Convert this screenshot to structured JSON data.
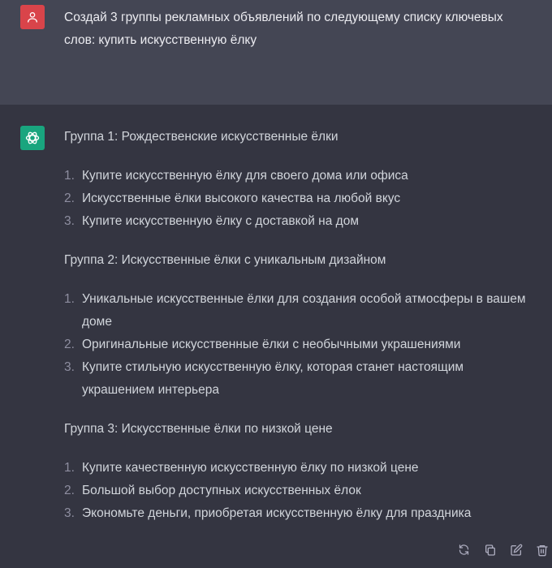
{
  "user_message": {
    "text": "Создай 3 группы рекламных объявлений по следующему списку ключевых слов: купить искусственную ёлку"
  },
  "assistant_message": {
    "groups": [
      {
        "title": "Группа 1: Рождественские искусственные ёлки",
        "items": [
          {
            "num": "1.",
            "text": "Купите искусственную ёлку для своего дома или офиса"
          },
          {
            "num": "2.",
            "text": "Искусственные ёлки высокого качества на любой вкус"
          },
          {
            "num": "3.",
            "text": "Купите искусственную ёлку с доставкой на дом"
          }
        ]
      },
      {
        "title": "Группа 2: Искусственные ёлки с уникальным дизайном",
        "items": [
          {
            "num": "1.",
            "text": "Уникальные искусственные ёлки для создания особой атмосферы в вашем доме"
          },
          {
            "num": "2.",
            "text": "Оригинальные искусственные ёлки с необычными украшениями"
          },
          {
            "num": "3.",
            "text": "Купите стильную искусственную ёлку, которая станет настоящим украшением интерьера"
          }
        ]
      },
      {
        "title": "Группа 3: Искусственные ёлки по низкой цене",
        "items": [
          {
            "num": "1.",
            "text": "Купите качественную искусственную ёлку по низкой цене"
          },
          {
            "num": "2.",
            "text": "Большой выбор доступных искусственных ёлок"
          },
          {
            "num": "3.",
            "text": "Экономьте деньги, приобретая искусственную ёлку для праздника"
          }
        ]
      }
    ]
  },
  "colors": {
    "user_bg": "#444654",
    "assistant_bg": "#343541",
    "user_avatar": "#d9444a",
    "bot_avatar": "#19a57e"
  },
  "icons": {
    "user_avatar": "user-icon",
    "bot_avatar": "openai-logo-icon",
    "actions": [
      "regenerate-icon",
      "copy-icon",
      "edit-icon",
      "delete-icon"
    ]
  }
}
